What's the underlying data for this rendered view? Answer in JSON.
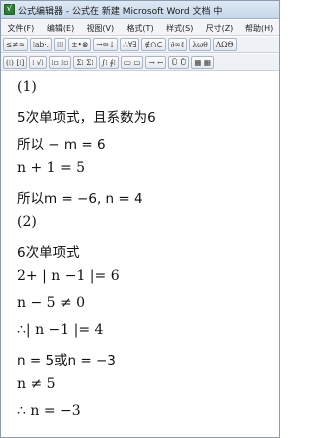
{
  "window": {
    "title": "公式编辑器 - 公式在 新建 Microsoft Word 文档 中"
  },
  "menu": [
    "文件(F)",
    "编辑(E)",
    "视图(V)",
    "格式(T)",
    "样式(S)",
    "尺寸(Z)",
    "帮助(H)"
  ],
  "toolbar_row1": [
    "≤≠≈",
    "⁞ab·.",
    "⁞⁞⁞",
    "±•⊗",
    "→⇔↓",
    "∴∀∃",
    "∉∩⊂",
    "∂∞ℓ",
    "λωθ",
    "ΛΩΘ"
  ],
  "toolbar_row2": [
    "(⁞) [⁞]",
    "⁞ √⁞",
    "⁞▫ ⁞▫",
    "Σ⁞ Σ⁞",
    "∫⁞ ∮⁞",
    "▭ ▭",
    "→ ←",
    "Ū Ů",
    "▦ ▦"
  ],
  "content": {
    "lines": [
      "(1)",
      "5次单项式，且系数为6",
      "所以 − m = 6",
      "n + 1 = 5",
      "所以m = −6, n = 4",
      "(2)",
      "6次单项式",
      "2+ | n −1 |= 6",
      "n − 5 ≠ 0",
      "∴| n −1 |= 4",
      "n = 5或n = −3",
      "n ≠ 5",
      "∴ n = −3"
    ]
  }
}
